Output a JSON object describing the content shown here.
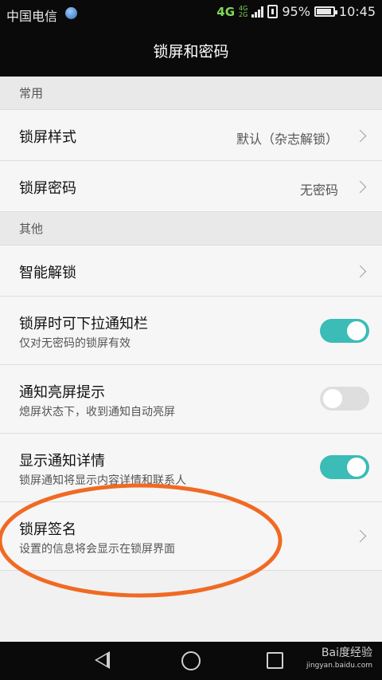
{
  "status_bar": {
    "carrier": "中国电信",
    "network": "4G",
    "network_alt_top": "4G",
    "network_alt_bottom": "2G",
    "battery": "95%",
    "time": "10:45"
  },
  "header": {
    "title": "锁屏和密码"
  },
  "sections": [
    {
      "label": "常用"
    },
    {
      "label": "其他"
    }
  ],
  "rows": {
    "style": {
      "title": "锁屏样式",
      "value": "默认（杂志解锁）"
    },
    "password": {
      "title": "锁屏密码",
      "value": "无密码"
    },
    "smart_unlock": {
      "title": "智能解锁"
    },
    "pull_notif": {
      "title": "锁屏时可下拉通知栏",
      "subtitle": "仅对无密码的锁屏有效",
      "enabled": true
    },
    "notif_wake": {
      "title": "通知亮屏提示",
      "subtitle": "熄屏状态下，收到通知自动亮屏",
      "enabled": false
    },
    "notif_detail": {
      "title": "显示通知详情",
      "subtitle": "锁屏通知将显示内容详情和联系人",
      "enabled": true
    },
    "signature": {
      "title": "锁屏签名",
      "subtitle": "设置的信息将会显示在锁屏界面"
    }
  },
  "watermark": {
    "line1": "Bai度经验",
    "line2": "jingyan.baidu.com"
  },
  "colors": {
    "accent": "#3bbcb6",
    "annotation": "#f06a23"
  },
  "icons": {
    "back": "back-icon",
    "home": "home-icon",
    "recent": "recent-apps-icon"
  }
}
